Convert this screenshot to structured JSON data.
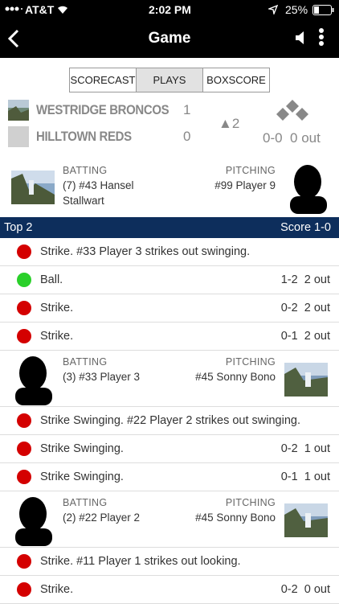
{
  "status": {
    "carrier": "AT&T",
    "time": "2:02 PM",
    "battery": "25%"
  },
  "nav": {
    "title": "Game"
  },
  "tabs": [
    "SCORECAST",
    "PLAYS",
    "BOXSCORE"
  ],
  "teams": [
    {
      "name": "WESTRIDGE BRONCOS",
      "runs": "1"
    },
    {
      "name": "HILLTOWN REDS",
      "runs": "0"
    }
  ],
  "inning": "▲2",
  "count": "0-0  0 out",
  "current": {
    "batting_label": "BATTING",
    "batting_value": "(7) #43 Hansel Stallwart",
    "pitching_label": "PITCHING",
    "pitching_value": "#99 Player 9"
  },
  "section": {
    "label": "Top 2",
    "score": "Score 1-0"
  },
  "plays": [
    {
      "text": "Strike. #33 Player 3 strikes out swinging.",
      "count": "",
      "color": "red"
    },
    {
      "text": "Ball.",
      "count": "1-2  2 out",
      "color": "green"
    },
    {
      "text": "Strike.",
      "count": "0-2  2 out",
      "color": "red"
    },
    {
      "text": "Strike.",
      "count": "0-1  2 out",
      "color": "red"
    }
  ],
  "ab2": {
    "batting_label": "BATTING",
    "batting_value": "(3) #33 Player 3",
    "pitching_label": "PITCHING",
    "pitching_value": "#45 Sonny Bono"
  },
  "plays2": [
    {
      "text": "Strike Swinging. #22 Player 2 strikes out swinging.",
      "count": "",
      "color": "red"
    },
    {
      "text": "Strike Swinging.",
      "count": "0-2  1 out",
      "color": "red"
    },
    {
      "text": "Strike Swinging.",
      "count": "0-1  1 out",
      "color": "red"
    }
  ],
  "ab3": {
    "batting_label": "BATTING",
    "batting_value": "(2) #22 Player 2",
    "pitching_label": "PITCHING",
    "pitching_value": "#45 Sonny Bono"
  },
  "plays3": [
    {
      "text": "Strike. #11 Player 1 strikes out looking.",
      "count": "",
      "color": "red"
    },
    {
      "text": "Strike.",
      "count": "0-2  0 out",
      "color": "red"
    }
  ]
}
